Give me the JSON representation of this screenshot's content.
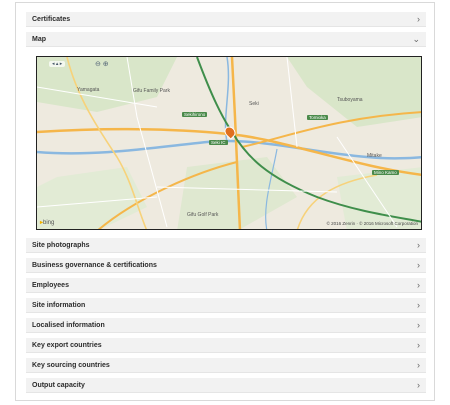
{
  "sections": {
    "certificates": "Certificates",
    "map": "Map",
    "site_photographs": "Site photographs",
    "business_governance": "Business governance & certifications",
    "employees": "Employees",
    "site_information": "Site information",
    "localised_information": "Localised information",
    "key_export_countries": "Key export countries",
    "key_sourcing_countries": "Key sourcing countries",
    "output_capacity": "Output capacity"
  },
  "icons": {
    "collapsed": "›",
    "expanded": "⌄"
  },
  "map": {
    "labels": {
      "yamagata": "Yamagata",
      "seki": "Seki",
      "mino_kamo": "Mino Kamo",
      "tsuboyama": "Tsuboyama",
      "gifu_family_park": "Gifu Family Park",
      "gifu_golf_park": "Gifu Golf Park",
      "mitake": "Mitake"
    },
    "road_labels": {
      "r1": "Sekihirono",
      "r2": "Seki IC",
      "r3": "Tomioka",
      "r4": "Mino Kamo"
    },
    "nav": "◂ ▴ ▸",
    "zoom": "⊖ ⊕",
    "bing": "bing",
    "copyright": "© 2016 Zenrin · © 2016 Microsoft Corporation"
  }
}
